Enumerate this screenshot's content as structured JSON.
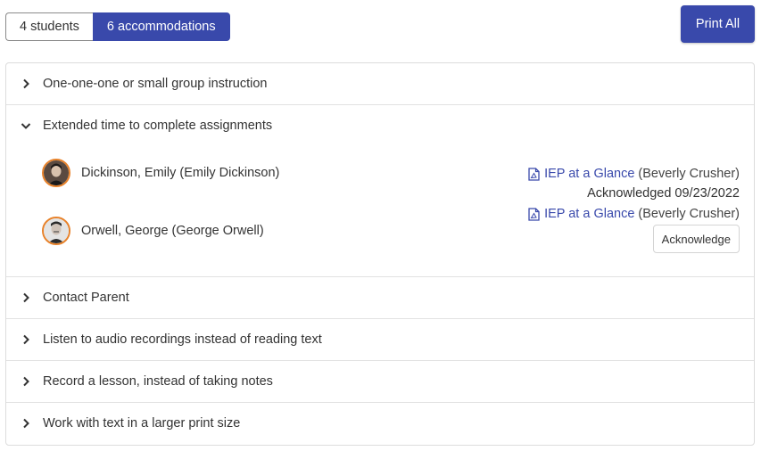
{
  "view_toggle": {
    "students_label": "4 students",
    "accommodations_label": "6 accommodations"
  },
  "print_all_label": "Print All",
  "accommodations": [
    {
      "title": "One-one-one or small group instruction",
      "expanded": false
    },
    {
      "title": "Extended time to complete assignments",
      "expanded": true,
      "students": [
        {
          "name": "Dickinson, Emily (Emily Dickinson)",
          "doc_link": "IEP at a Glance",
          "doc_author": "(Beverly Crusher)",
          "status": "Acknowledged 09/23/2022"
        },
        {
          "name": "Orwell, George (George Orwell)",
          "doc_link": "IEP at a Glance",
          "doc_author": "(Beverly Crusher)",
          "action_label": "Acknowledge"
        }
      ]
    },
    {
      "title": "Contact Parent",
      "expanded": false
    },
    {
      "title": "Listen to audio recordings instead of reading text",
      "expanded": false
    },
    {
      "title": "Record a lesson, instead of taking notes",
      "expanded": false
    },
    {
      "title": "Work with text in a larger print size",
      "expanded": false
    }
  ],
  "colors": {
    "accent": "#3949ab",
    "avatar_ring": "#e8822a"
  },
  "icons": {
    "collapsed": "chevron-right-icon",
    "expanded": "chevron-down-icon",
    "document": "pdf-file-icon"
  }
}
